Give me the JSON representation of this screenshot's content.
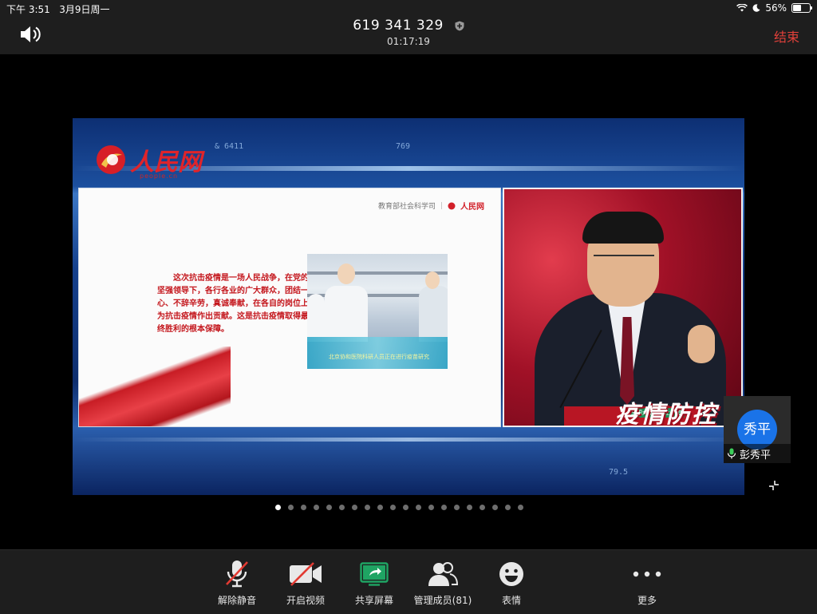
{
  "status_bar": {
    "time": "下午 3:51",
    "date": "3月9日周一",
    "battery": "56%",
    "battery_level": 0.56
  },
  "header": {
    "meeting_id": "619 341 329",
    "timer": "01:17:19",
    "end_label": "结束"
  },
  "shared_screen": {
    "logo_text": "人民网",
    "logo_sub": "people.cn",
    "hud_numbers": [
      "& 6411",
      "769",
      "79.5"
    ],
    "slide": {
      "header_left": "教育部社会科学司",
      "header_logo": "人民网",
      "body_text": "这次抗击疫情是一场人民战争，在党的坚强领导下，各行各业的广大群众，团结一心、不辞辛劳，真诚奉献，在各自的岗位上为抗击疫情作出贡献。这是抗击疫情取得最终胜利的根本保障。",
      "photo_caption": "北京协和医院科研人员正在进行疫苗研究"
    },
    "video": {
      "banner_title": "疫情防控",
      "banner_small": "全国大学生同上一堂"
    }
  },
  "participant": {
    "avatar_text": "秀平",
    "name": "彭秀平"
  },
  "pager": {
    "count": 20,
    "active_index": 0
  },
  "toolbar": {
    "unmute": "解除静音",
    "start_video": "开启视频",
    "share_screen": "共享屏幕",
    "participants": "管理成员(81)",
    "reactions": "表情",
    "more": "更多"
  },
  "colors": {
    "end_red": "#e0403a",
    "avatar_blue": "#1a73e8",
    "share_green": "#1fa463"
  }
}
